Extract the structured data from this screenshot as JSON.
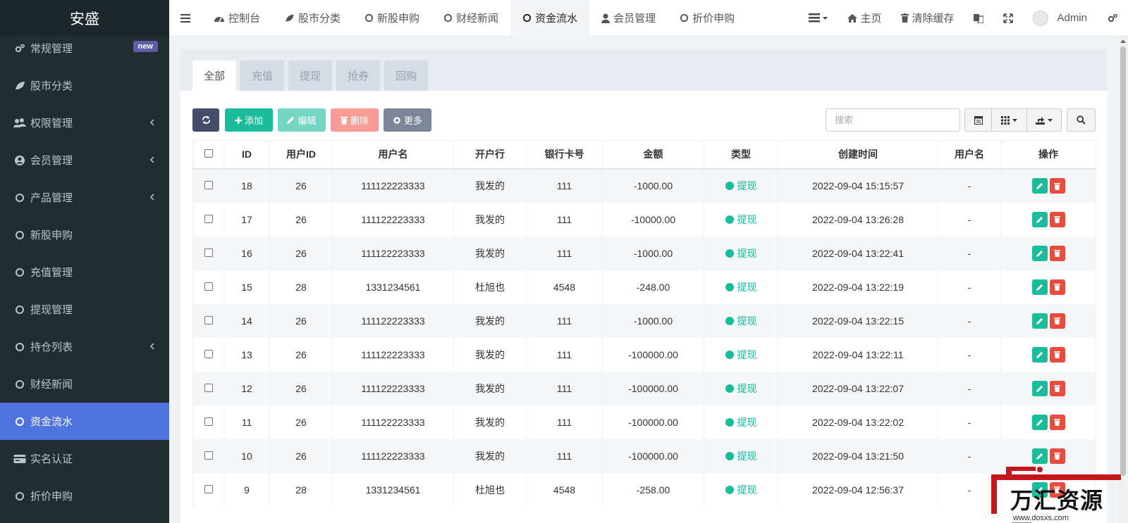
{
  "brand": "安盛",
  "sidebar": {
    "items": [
      {
        "label": "常规管理",
        "icon": "gears-icon",
        "badge": "new",
        "chevron": false,
        "active": false
      },
      {
        "label": "股市分类",
        "icon": "leaf-icon",
        "chevron": false,
        "active": false
      },
      {
        "label": "权限管理",
        "icon": "users-icon",
        "chevron": true,
        "active": false
      },
      {
        "label": "会员管理",
        "icon": "user-circle-icon",
        "chevron": true,
        "active": false
      },
      {
        "label": "产品管理",
        "icon": "circle-icon",
        "chevron": true,
        "active": false
      },
      {
        "label": "新股申购",
        "icon": "circle-icon",
        "chevron": false,
        "active": false
      },
      {
        "label": "充值管理",
        "icon": "circle-icon",
        "chevron": false,
        "active": false
      },
      {
        "label": "提现管理",
        "icon": "circle-icon",
        "chevron": false,
        "active": false
      },
      {
        "label": "持仓列表",
        "icon": "circle-icon",
        "chevron": true,
        "active": false
      },
      {
        "label": "财经新闻",
        "icon": "circle-icon",
        "chevron": false,
        "active": false
      },
      {
        "label": "资金流水",
        "icon": "circle-icon",
        "chevron": false,
        "active": true
      },
      {
        "label": "实名认证",
        "icon": "id-card-icon",
        "chevron": false,
        "active": false
      },
      {
        "label": "折价申购",
        "icon": "circle-icon",
        "chevron": false,
        "active": false
      }
    ]
  },
  "topnav": {
    "items": [
      {
        "label": "控制台",
        "icon": "dashboard-icon",
        "active": false
      },
      {
        "label": "股市分类",
        "icon": "leaf-icon",
        "active": false
      },
      {
        "label": "新股申购",
        "icon": "circle-icon",
        "active": false
      },
      {
        "label": "财经新闻",
        "icon": "circle-icon",
        "active": false
      },
      {
        "label": "资金流水",
        "icon": "circle-icon",
        "active": true
      },
      {
        "label": "会员管理",
        "icon": "user-icon",
        "active": false
      },
      {
        "label": "折价申购",
        "icon": "circle-icon",
        "active": false
      }
    ],
    "home": "主页",
    "clear_cache": "清除缓存",
    "user": "Admin"
  },
  "tabs": [
    "全部",
    "充值",
    "提现",
    "抢券",
    "回购"
  ],
  "toolbar": {
    "add": "添加",
    "edit": "编辑",
    "delete": "删除",
    "more": "更多",
    "search_placeholder": "搜索"
  },
  "table": {
    "headers": [
      "ID",
      "用户ID",
      "用户名",
      "开户行",
      "银行卡号",
      "金额",
      "类型",
      "创建时间",
      "用户名",
      "操作"
    ],
    "rows": [
      {
        "id": "18",
        "uid": "26",
        "username": "111122223333",
        "bank": "我发的",
        "card": "111",
        "amount": "-1000.00",
        "type": "提现",
        "created": "2022-09-04 15:15:57",
        "name": "-"
      },
      {
        "id": "17",
        "uid": "26",
        "username": "111122223333",
        "bank": "我发的",
        "card": "111",
        "amount": "-10000.00",
        "type": "提现",
        "created": "2022-09-04 13:26:28",
        "name": "-"
      },
      {
        "id": "16",
        "uid": "26",
        "username": "111122223333",
        "bank": "我发的",
        "card": "111",
        "amount": "-1000.00",
        "type": "提现",
        "created": "2022-09-04 13:22:41",
        "name": "-"
      },
      {
        "id": "15",
        "uid": "28",
        "username": "1331234561",
        "bank": "杜旭也",
        "card": "4548",
        "amount": "-248.00",
        "type": "提现",
        "created": "2022-09-04 13:22:19",
        "name": "-"
      },
      {
        "id": "14",
        "uid": "26",
        "username": "111122223333",
        "bank": "我发的",
        "card": "111",
        "amount": "-1000.00",
        "type": "提现",
        "created": "2022-09-04 13:22:15",
        "name": "-"
      },
      {
        "id": "13",
        "uid": "26",
        "username": "111122223333",
        "bank": "我发的",
        "card": "111",
        "amount": "-100000.00",
        "type": "提现",
        "created": "2022-09-04 13:22:11",
        "name": "-"
      },
      {
        "id": "12",
        "uid": "26",
        "username": "111122223333",
        "bank": "我发的",
        "card": "111",
        "amount": "-100000.00",
        "type": "提现",
        "created": "2022-09-04 13:22:07",
        "name": "-"
      },
      {
        "id": "11",
        "uid": "26",
        "username": "111122223333",
        "bank": "我发的",
        "card": "111",
        "amount": "-100000.00",
        "type": "提现",
        "created": "2022-09-04 13:22:02",
        "name": "-"
      },
      {
        "id": "10",
        "uid": "26",
        "username": "111122223333",
        "bank": "我发的",
        "card": "111",
        "amount": "-100000.00",
        "type": "提现",
        "created": "2022-09-04 13:21:50",
        "name": "-"
      },
      {
        "id": "9",
        "uid": "28",
        "username": "1331234561",
        "bank": "杜旭也",
        "card": "4548",
        "amount": "-258.00",
        "type": "提现",
        "created": "2022-09-04 12:56:37",
        "name": "-"
      }
    ]
  },
  "watermark": {
    "title": "万汇资源网",
    "url": "www.dosxs.com"
  },
  "colors": {
    "sidebar": "#222d32",
    "active": "#4e73df",
    "success": "#1abc9c",
    "danger": "#e74c3c"
  }
}
